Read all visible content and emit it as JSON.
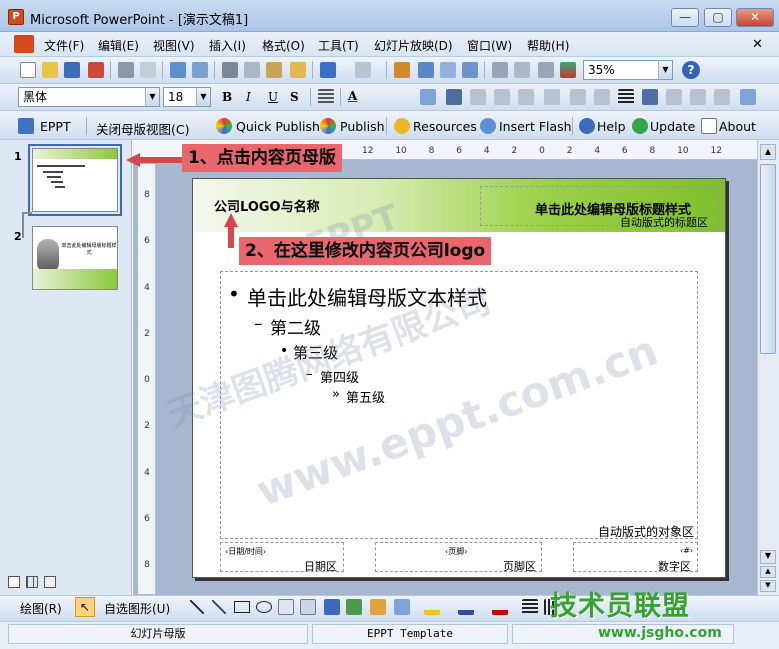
{
  "window": {
    "app_icon": "P",
    "title": "Microsoft PowerPoint - [演示文稿1]",
    "min_glyph": "—",
    "max_glyph": "▢",
    "close_glyph": "✕"
  },
  "menubar": {
    "items": [
      "文件(F)",
      "编辑(E)",
      "视图(V)",
      "插入(I)",
      "格式(O)",
      "工具(T)",
      "幻灯片放映(D)",
      "窗口(W)",
      "帮助(H)"
    ],
    "close_glyph": "✕"
  },
  "toolbar_standard": {
    "zoom": "35%",
    "help_glyph": "?"
  },
  "toolbar_format": {
    "font": "黑体",
    "size": "18",
    "bold": "B",
    "italic": "I",
    "underline": "U",
    "shadow": "S",
    "font_color": "A"
  },
  "toolbar_addins": {
    "eppt": "EPPT",
    "close_master": "关闭母版视图(C)",
    "quick_publish": "Quick Publish",
    "publish": "Publish",
    "resources": "Resources",
    "insert_flash": "Insert Flash",
    "help": "Help",
    "update": "Update",
    "about": "About"
  },
  "ruler": {
    "h_labels": [
      "12",
      "10",
      "8",
      "6",
      "4",
      "2",
      "0",
      "2",
      "4",
      "6",
      "8",
      "10",
      "12"
    ],
    "v_labels": [
      "8",
      "6",
      "4",
      "2",
      "0",
      "2",
      "4",
      "6",
      "8"
    ]
  },
  "thumbnails": {
    "numbers": [
      "1",
      "2"
    ],
    "thumb2_title": "单击此处编辑母版标题样式"
  },
  "slide": {
    "logo_text": "公司LOGO与名称",
    "title_placeholder": "单击此处编辑母版标题样式",
    "title_area_label": "自动版式的标题区",
    "level1": "单击此处编辑母版文本样式",
    "level2": "第二级",
    "level3": "第三级",
    "level4": "第四级",
    "level5": "第五级",
    "bullet1": "•",
    "bullet2": "–",
    "bullet3": "•",
    "bullet4": "–",
    "bullet5": "»",
    "object_area_label": "自动版式的对象区",
    "date_placeholder": "‹日期/时间›",
    "date_label": "日期区",
    "footer_placeholder": "‹页脚›",
    "footer_label": "页脚区",
    "number_placeholder": "‹#›",
    "number_label": "数字区"
  },
  "annotations": {
    "step1": "1、点击内容页母版",
    "step2": "2、在这里修改内容页公司logo"
  },
  "watermarks": {
    "w1": "www.eppt.com.cn",
    "w2": "天津图腾网络有限公司",
    "w3": "EPPT"
  },
  "bottom_toolbar": {
    "draw": "绘图(R)",
    "autoshape": "自选图形(U)"
  },
  "statusbar": {
    "view": "幻灯片母版",
    "template": "EPPT Template"
  },
  "branding": {
    "logo_text": "技术员联盟",
    "url": "www.jsgho.com"
  },
  "colors": {
    "accent_green": "#7fbf2d",
    "callout_red": "#e8666c",
    "arrow_red": "#d6464d",
    "logo_green": "#35a32f"
  }
}
